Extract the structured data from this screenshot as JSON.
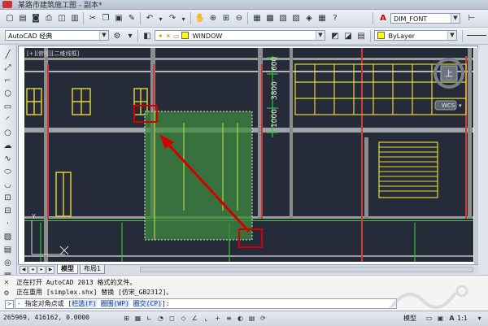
{
  "window": {
    "title": "某路市建筑施工图 - 副本*"
  },
  "toolbar_top": {
    "dimstyle_combo": "DIM_FONT",
    "buttons": [
      "new-icon",
      "open-icon",
      "save-icon",
      "plot-icon",
      "preview-icon",
      "publish-icon",
      "cut-icon",
      "copy-icon",
      "paste-icon",
      "match-icon",
      "undo-icon",
      "redo-icon",
      "pan-icon",
      "zoom-icon",
      "zoom-window-icon",
      "zoom-prev-icon",
      "properties-icon",
      "design-center-icon",
      "tool-palette-icon",
      "sheet-set-icon",
      "markup-icon",
      "calc-icon",
      "help-icon"
    ]
  },
  "toolbar_second": {
    "workspace_combo": "AutoCAD 经典",
    "layer_combo": "WINDOW",
    "linetype_combo": "ByLayer",
    "layer_color": "#ffff00"
  },
  "drawing": {
    "dimensions": [
      "600",
      "3800",
      "1000"
    ],
    "viewcube_label": "上",
    "wcs_label": "WCS",
    "axis_y_label": "Y",
    "title_block_text": "[+][俯视][二维线框]",
    "highlight_color": "#d40000",
    "selection_fill": "#3f8a3f"
  },
  "layout_tabs": {
    "tabs": [
      "模型",
      "布局1"
    ],
    "active": "模型"
  },
  "command": {
    "history": [
      "正在打开 AutoCAD 2013 格式的文件。",
      "正在重用 [simplex.shx] 替换 [仿宋_GB2312]。"
    ],
    "prompt_prefix": "- 指定对角点或",
    "options": [
      "栏选(F)",
      "圈围(WP)",
      "圈交(CP)"
    ],
    "prompt_suffix": "]:",
    "bracket_open": "["
  },
  "status": {
    "coords": "265969, 416162, 0.0000",
    "model_label": "模型",
    "scale_label": "1:1"
  }
}
